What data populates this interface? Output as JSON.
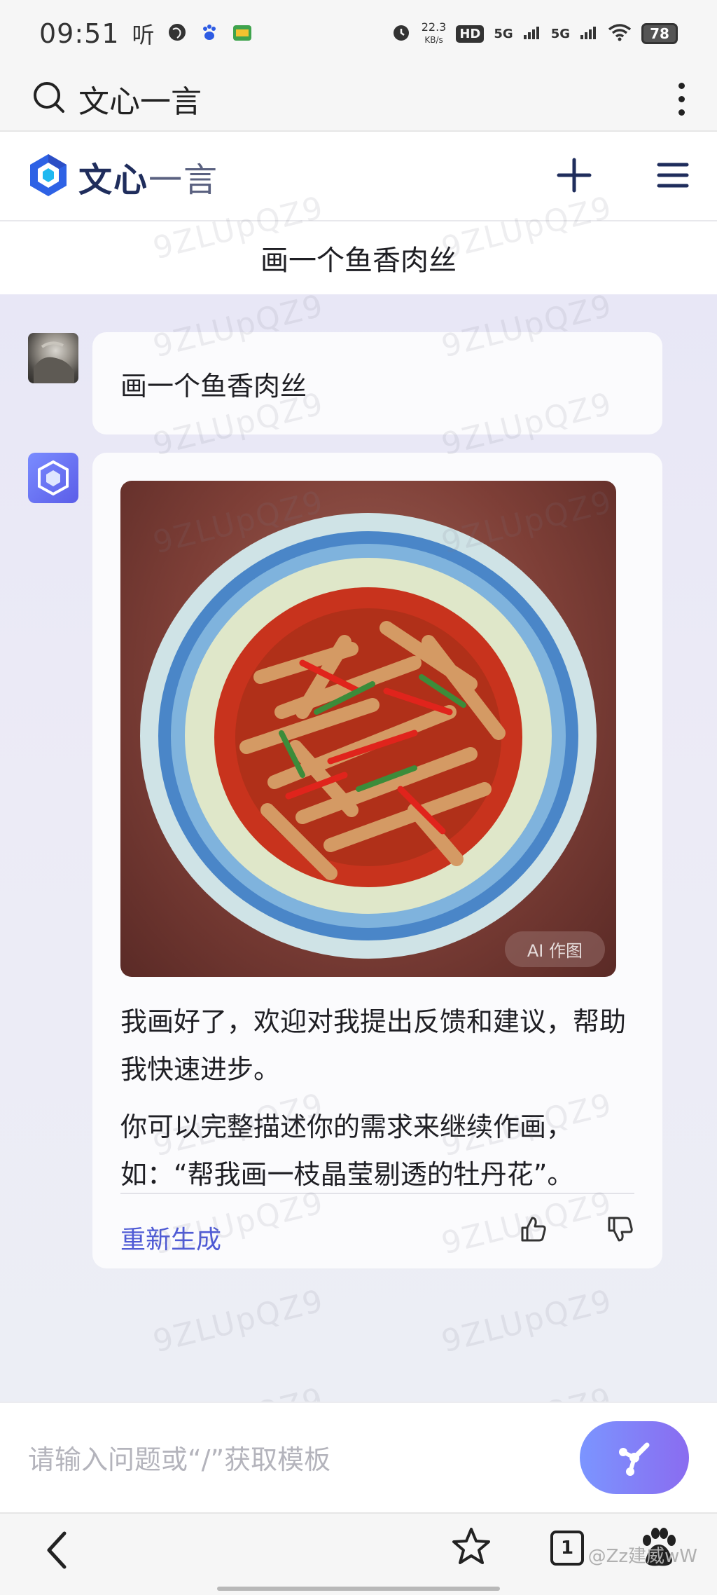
{
  "status_bar": {
    "time": "09:51",
    "listen_label": "听",
    "net_speed_value": "22.3",
    "net_speed_unit": "KB/s",
    "hd_label": "HD",
    "network_1": "5G",
    "network_2": "5G",
    "battery": "78"
  },
  "browser": {
    "search_title": "文心一言"
  },
  "app_header": {
    "logo_bold": "文心",
    "logo_light": "一言"
  },
  "conversation": {
    "title": "画一个鱼香肉丝"
  },
  "messages": {
    "user_text": "画一个鱼香肉丝",
    "image_badge": "AI 作图",
    "bot_paragraph_1": "我画好了，欢迎对我提出反馈和建议，帮助我快速进步。",
    "bot_paragraph_2": "你可以完整描述你的需求来继续作画，如：“帮我画一枝晶莹剔透的牡丹花”。",
    "regenerate_label": "重新生成"
  },
  "watermark": "9ZLUpQZ9",
  "input": {
    "placeholder": "请输入问题或“/”获取模板"
  },
  "bottom_nav": {
    "tab_count": "1"
  },
  "footer_tag": "@Zz建威wW",
  "colors": {
    "accent": "#4f5bd5",
    "brand_navy": "#1f2d5c",
    "chat_bg": "#e8e7f6"
  }
}
